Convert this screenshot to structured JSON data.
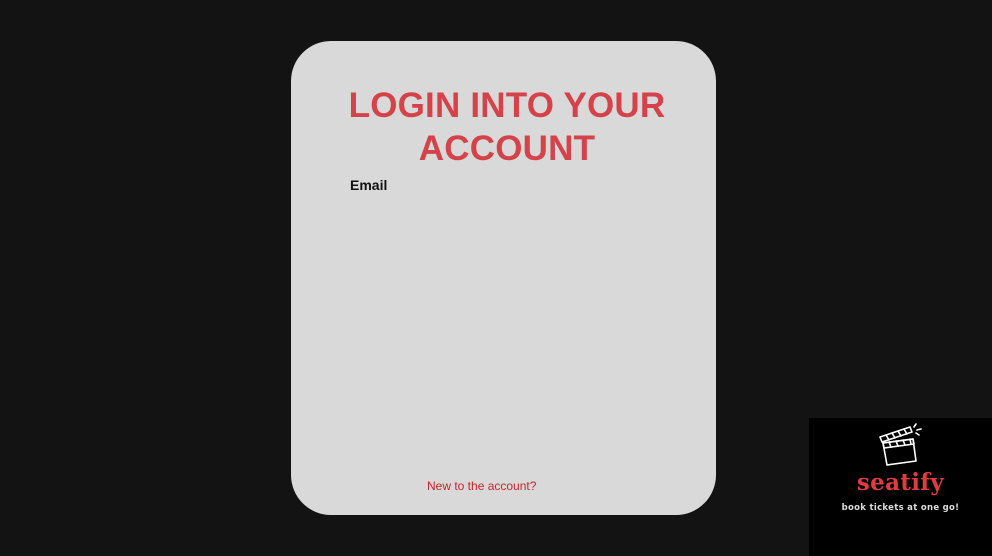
{
  "login_card": {
    "title": "LOGIN INTO YOUR ACCOUNT",
    "email_label": "Email",
    "signup_link": "New to the account?"
  },
  "brand": {
    "name": "seatify",
    "tagline": "book tickets at one go!",
    "icon": "clapperboard-icon"
  },
  "colors": {
    "background": "#131313",
    "card": "#d9d9d9",
    "accent": "#d5434a",
    "link": "#c4262e",
    "logo_bg": "#000000"
  }
}
